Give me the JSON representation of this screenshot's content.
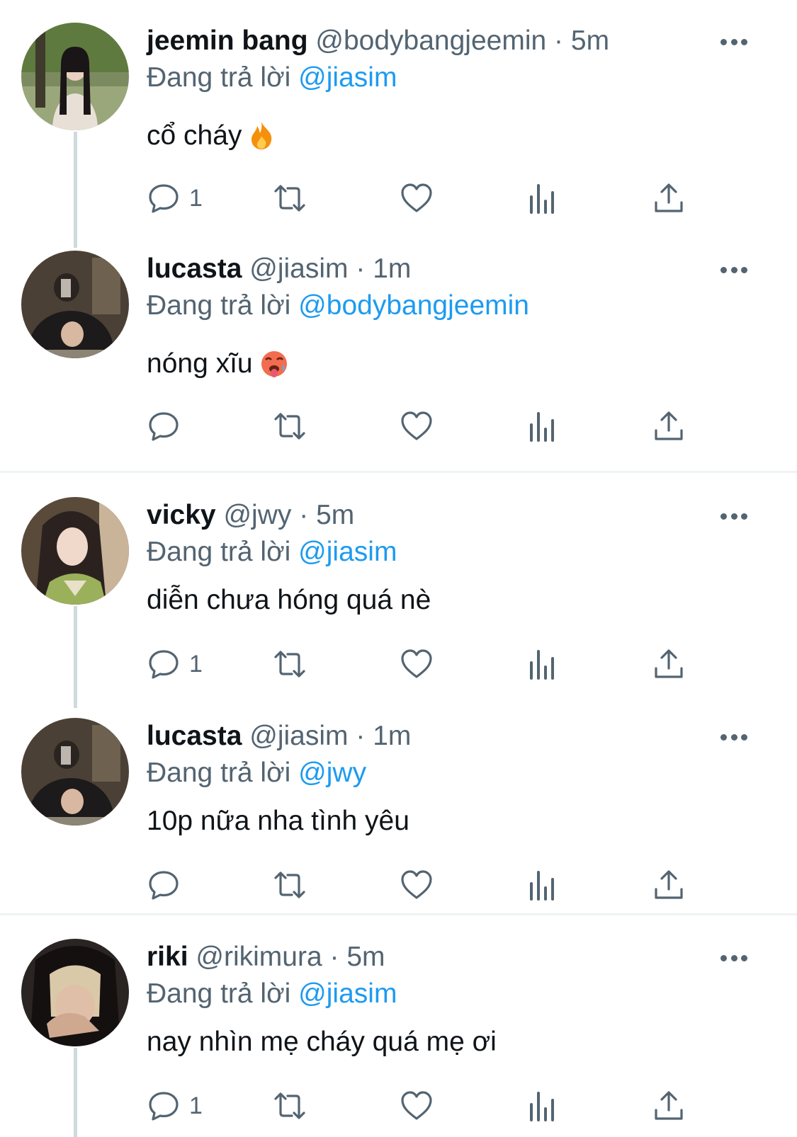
{
  "tweets": [
    {
      "name": "jeemin bang",
      "handle": "@bodybangjeemin",
      "dot": "·",
      "time": "5m",
      "reply_prefix": "Đang trả lời",
      "reply_to": "@jiasim",
      "text": "cổ cháy",
      "emoji": "fire",
      "reply_count": "1"
    },
    {
      "name": "lucasta",
      "handle": "@jiasim",
      "dot": "·",
      "time": "1m",
      "reply_prefix": "Đang trả lời",
      "reply_to": "@bodybangjeemin",
      "text": "nóng xĩu",
      "emoji": "hot-face",
      "reply_count": ""
    },
    {
      "name": "vicky",
      "handle": "@jwy",
      "dot": "·",
      "time": "5m",
      "reply_prefix": "Đang trả lời",
      "reply_to": "@jiasim",
      "text": "diễn chưa hóng quá nè",
      "reply_count": "1"
    },
    {
      "name": "lucasta",
      "handle": "@jiasim",
      "dot": "·",
      "time": "1m",
      "reply_prefix": "Đang trả lời",
      "reply_to": "@jwy",
      "text": "10p nữa nha tình yêu",
      "reply_count": ""
    },
    {
      "name": "riki",
      "handle": "@rikimura",
      "dot": "·",
      "time": "5m",
      "reply_prefix": "Đang trả lời",
      "reply_to": "@jiasim",
      "text": "nay nhìn mẹ cháy quá mẹ ơi",
      "reply_count": "1"
    }
  ],
  "colors": {
    "mention": "#1d9bf0",
    "secondary_text": "#536471",
    "thread_line": "#cfd9de",
    "divider": "#eff3f4"
  },
  "icons": [
    "more-icon",
    "reply-icon",
    "retweet-icon",
    "like-icon",
    "views-icon",
    "share-icon"
  ]
}
